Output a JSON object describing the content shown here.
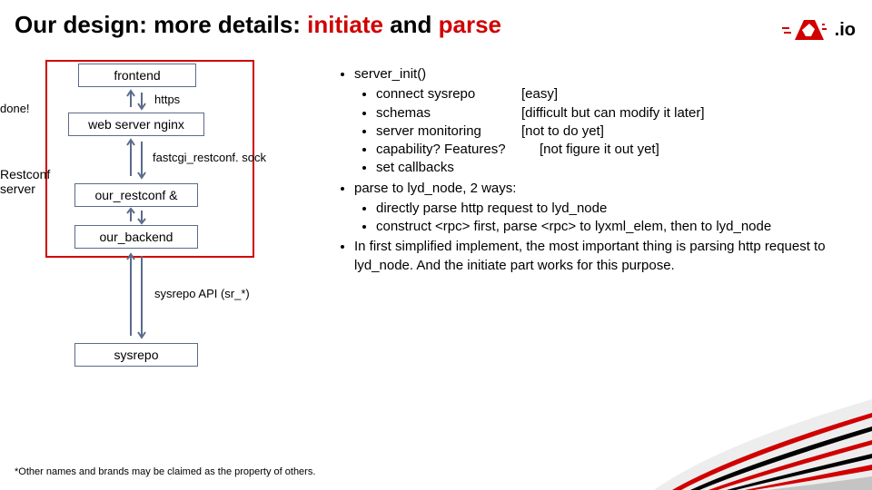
{
  "title": {
    "part1": "Our design: more details: ",
    "red1": "initiate",
    "mid": " and ",
    "red2": "parse"
  },
  "logo_suffix": ".io",
  "diagram": {
    "done_label": "done!",
    "frontend": "frontend",
    "https_label": "https",
    "webserver": "web server nginx",
    "fastcgi_label": "fastcgi_restconf. sock",
    "restconf_label1": "Restconf",
    "restconf_label2": "server",
    "our_restconf": "our_restconf &",
    "our_backend": "our_backend",
    "sysrepo_api_label": "sysrepo API (sr_*)",
    "sysrepo": "sysrepo"
  },
  "bullets": {
    "b1": "server_init()",
    "b1_1a": "connect sysrepo",
    "b1_1b": "[easy]",
    "b1_2a": "schemas",
    "b1_2b": "[difficult but can modify it later]",
    "b1_3a": "server monitoring",
    "b1_3b": "[not to do yet]",
    "b1_4a": "capability?  Features?",
    "b1_4b": "[not figure it out yet]",
    "b1_5": "set callbacks",
    "b2": "parse to lyd_node, 2 ways:",
    "b2_1": "directly parse http request to lyd_node",
    "b2_2": "construct <rpc> first, parse <rpc> to lyxml_elem, then to lyd_node",
    "b3": "In first simplified implement, the most important thing is parsing http request to lyd_node. And the initiate part works for this purpose."
  },
  "footnote": "*Other names and brands may be claimed as the property of others."
}
